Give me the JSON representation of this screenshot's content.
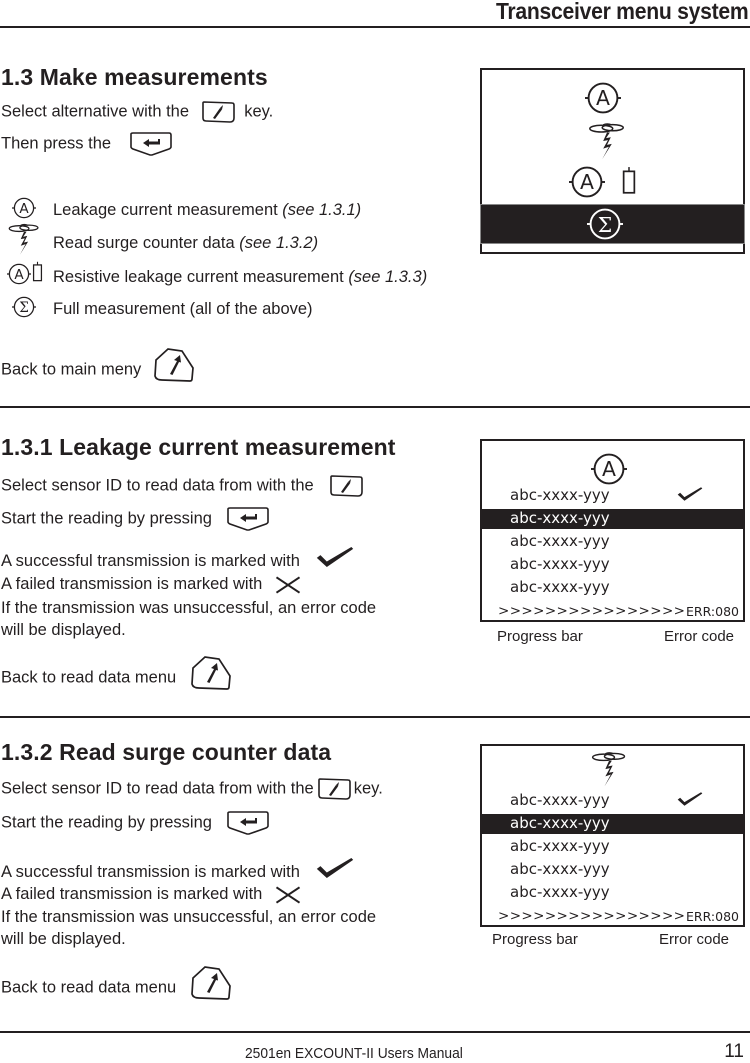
{
  "header": {
    "title": "Transceiver menu system"
  },
  "section_1_3": {
    "heading": "1.3 Make measurements",
    "line1_before": "Select alternative with the",
    "line1_after": "key.",
    "line2": "Then press the",
    "legend": [
      {
        "icon": "ammeter-icon",
        "label": "Leakage current measurement ",
        "ref": "(see 1.3.1)"
      },
      {
        "icon": "surge-lightning-icon",
        "label": "Read surge counter data ",
        "ref": "(see 1.3.2)"
      },
      {
        "icon": "resistive-ammeter-icon",
        "label": "Resistive leakage current measurement ",
        "ref": "(see 1.3.3)"
      },
      {
        "icon": "sigma-icon",
        "label": "Full measurement (all of the above)",
        "ref": ""
      }
    ],
    "back": "Back to main meny",
    "screen": {
      "items": [
        "ammeter-icon",
        "surge-lightning-icon",
        "resistive-ammeter-icon",
        "sigma-icon"
      ],
      "selected_index": 3,
      "sigma_glyph": "Σ",
      "a_glyph": "A"
    }
  },
  "section_1_3_1": {
    "heading": "1.3.1 Leakage current measurement",
    "select_line": "Select sensor ID to read data from with the",
    "start_line": "Start the reading by pressing",
    "success_line": "A successful transmission is marked with",
    "fail_line": "A failed transmission is marked with",
    "error_line1": "If the transmission was unsuccessful, an error code",
    "error_line2": "will be displayed.",
    "back": "Back to  read data menu",
    "screen": {
      "header_icon": "ammeter-icon",
      "a_glyph": "A",
      "rows": [
        "abc-xxxx-yyy",
        "abc-xxxx-yyy",
        "abc-xxxx-yyy",
        "abc-xxxx-yyy",
        "abc-xxxx-yyy"
      ],
      "selected_index": 1,
      "checked_index": 0,
      "progress": ">>>>>>>>>>>>>>>>",
      "error_code": "ERR:080"
    },
    "caption_progress": "Progress bar",
    "caption_error": "Error code"
  },
  "section_1_3_2": {
    "heading": "1.3.2 Read surge counter data",
    "select_line": "Select sensor ID to read data from with the",
    "select_after": "key.",
    "start_line": "Start the reading by pressing",
    "success_line": "A successful transmission is marked with",
    "fail_line": "A failed transmission is marked with",
    "error_line1": "If the transmission was unsuccessful, an error code",
    "error_line2": "will be displayed.",
    "back": "Back to  read data menu",
    "screen": {
      "header_icon": "surge-lightning-icon",
      "rows": [
        "abc-xxxx-yyy",
        "abc-xxxx-yyy",
        "abc-xxxx-yyy",
        "abc-xxxx-yyy",
        "abc-xxxx-yyy"
      ],
      "selected_index": 1,
      "checked_index": 0,
      "progress": ">>>>>>>>>>>>>>>>",
      "error_code": "ERR:080"
    },
    "caption_progress": "Progress bar",
    "caption_error": "Error code"
  },
  "footer": {
    "manual": "2501en EXCOUNT-II Users Manual",
    "page": "11"
  }
}
